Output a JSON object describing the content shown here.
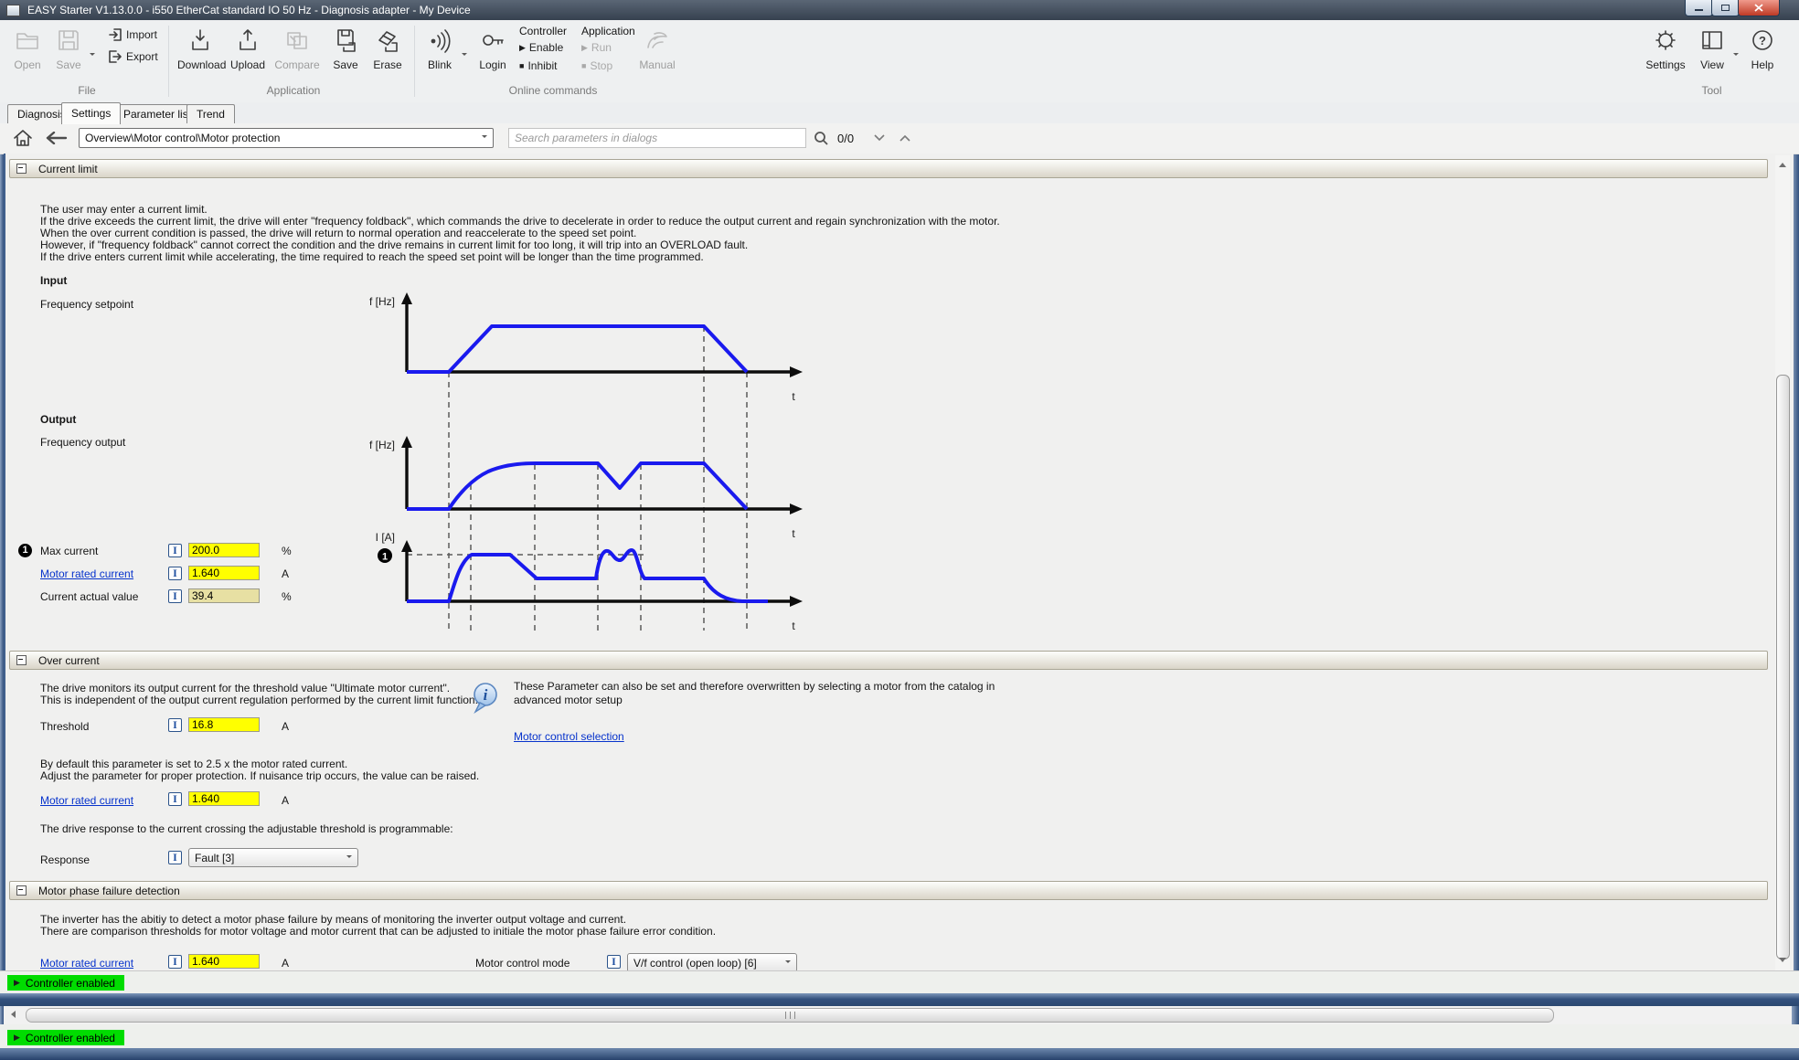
{
  "win": {
    "title": "EASY Starter V1.13.0.0 - i550 EtherCat standard IO 50 Hz - Diagnosis adapter - My Device"
  },
  "ribbon": {
    "file": {
      "label": "File",
      "open": "Open",
      "save": "Save",
      "import": "Import",
      "export": "Export"
    },
    "app": {
      "label": "Application",
      "download": "Download",
      "upload": "Upload",
      "compare": "Compare",
      "save": "Save",
      "erase": "Erase"
    },
    "online": {
      "label": "Online commands",
      "blink": "Blink",
      "login": "Login",
      "controller": "Controller",
      "enable": "Enable",
      "inhibit": "Inhibit",
      "application": "Application",
      "run": "Run",
      "stop": "Stop",
      "manual": "Manual"
    },
    "tool": {
      "label": "Tool",
      "settings": "Settings",
      "view": "View",
      "help": "Help"
    }
  },
  "tabs": {
    "diagnosis": "Diagnosis",
    "settings": "Settings",
    "parameter_list": "Parameter list",
    "trend": "Trend"
  },
  "nav": {
    "breadcrumb": "Overview\\Motor control\\Motor protection",
    "search_placeholder": "Search parameters in dialogs",
    "counter": "0/0"
  },
  "ui": {
    "param_info": "I"
  },
  "cl": {
    "title": "Current limit",
    "d1": "The user may enter a current limit.",
    "d2": "If the drive exceeds the current limit, the drive will enter \"frequency foldback\", which commands the drive to decelerate in order to reduce the output current and regain synchronization with the motor.",
    "d3": "When the over current condition is passed, the drive will return to normal operation and reaccelerate to the speed set point.",
    "d4": "However, if \"frequency foldback\" cannot correct the condition and the drive remains in current limit for too long, it will trip into an OVERLOAD fault.",
    "d5": "If the drive enters current limit while accelerating, the time required to reach the speed set point will be longer than the time programmed.",
    "input_h": "Input",
    "input_c": "Frequency setpoint",
    "output_h": "Output",
    "output_c": "Frequency output",
    "marker": "1",
    "ax": {
      "f": "f [Hz]",
      "i": "I [A]",
      "t": "t"
    },
    "rows": {
      "max": {
        "label": "Max current",
        "value": "200.0",
        "unit": "%"
      },
      "rated": {
        "label": "Motor rated current",
        "value": "1.640",
        "unit": "A"
      },
      "actual": {
        "label": "Current actual value",
        "value": "39.4",
        "unit": "%"
      }
    }
  },
  "oc": {
    "title": "Over current",
    "d1": "The drive monitors its output current for the threshold value \"Ultimate motor current\".",
    "d2": "This is independent of the output current regulation performed by the current limit function.",
    "threshold": {
      "label": "Threshold",
      "value": "16.8",
      "unit": "A"
    },
    "n1": "By default this parameter is set to 2.5 x the motor rated current.",
    "n2": "Adjust the parameter for proper protection. If nuisance trip occurs, the value can be raised.",
    "rated": {
      "label": "Motor rated current",
      "value": "1.640",
      "unit": "A"
    },
    "resp_desc": "The drive response to the current crossing the adjustable threshold is programmable:",
    "response": {
      "label": "Response",
      "value": "Fault [3]"
    },
    "info": "These Parameter can also be set and therefore overwritten by selecting a motor from the catalog in advanced motor setup",
    "info_link": "Motor control selection"
  },
  "mp": {
    "title": "Motor phase failure detection",
    "d1": "The inverter has the abitiy to detect a motor phase failure by means of monitoring the inverter output voltage and current.",
    "d2": "There are comparison thresholds for motor voltage and motor current that can be adjusted to initiale the motor phase failure error condition.",
    "rated": {
      "label": "Motor rated current",
      "value": "1.640",
      "unit": "A"
    },
    "mode": {
      "label": "Motor control mode",
      "value": "V/f control (open loop) [6]"
    }
  },
  "status": {
    "s1": "Controller enabled",
    "s2": "Controller enabled"
  },
  "icons": {
    "open": "folder-icon",
    "save": "floppy-icon",
    "import": "import-arrow-icon",
    "export": "export-arrow-icon",
    "download": "download-to-device-icon",
    "upload": "upload-from-device-icon",
    "compare": "compare-icon",
    "erase": "eraser-icon",
    "blink": "signal-icon",
    "login": "key-icon",
    "manual": "hand-icon",
    "settings": "gear-icon",
    "view": "window-pane-icon",
    "help": "question-icon",
    "home": "home-icon",
    "back": "back-arrow-icon",
    "search": "magnifier-icon",
    "info": "info-balloon-icon"
  },
  "colors": {
    "chart_blue": "#1a1aee",
    "field_yellow": "#ffff00",
    "field_readonly": "#e7e0a3",
    "status_green": "#00dc00",
    "link_blue": "#0733cc"
  }
}
